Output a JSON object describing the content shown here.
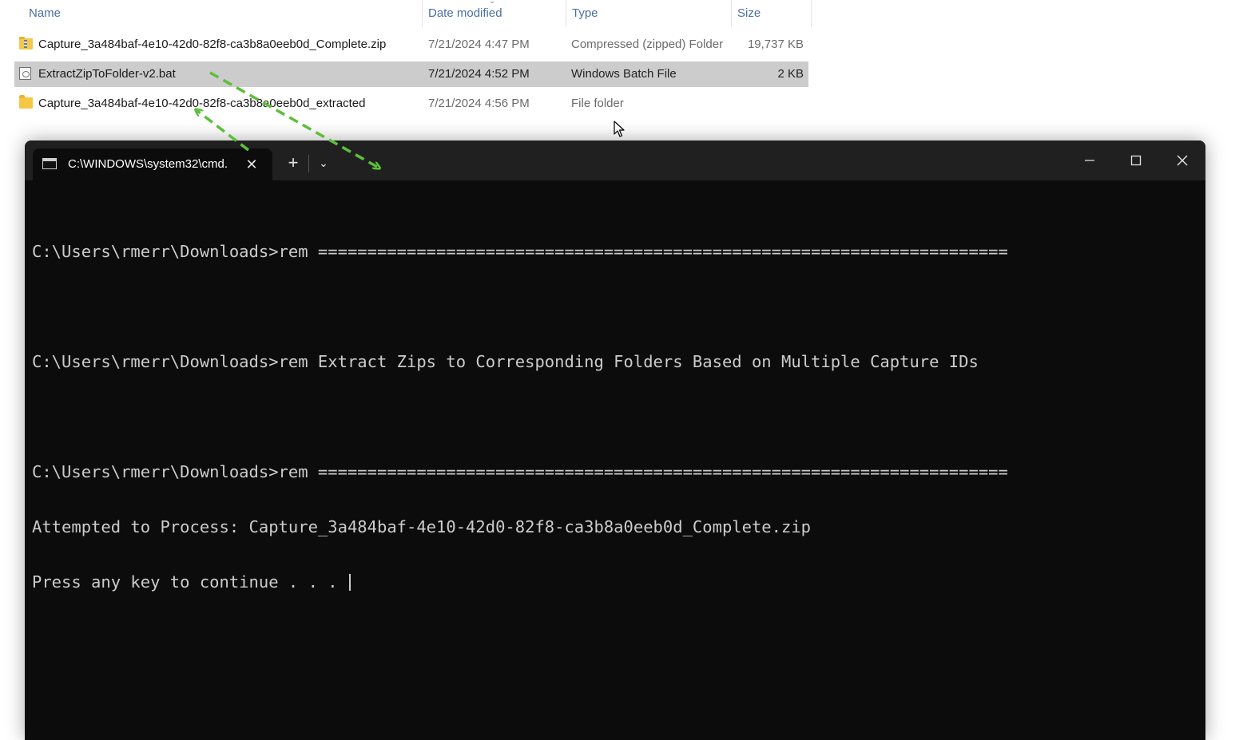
{
  "explorer": {
    "columns": {
      "name": "Name",
      "date_modified": "Date modified",
      "type": "Type",
      "size": "Size"
    },
    "files": [
      {
        "name": "Capture_3a484baf-4e10-42d0-82f8-ca3b8a0eeb0d_Complete.zip",
        "date": "7/21/2024 4:47 PM",
        "type": "Compressed (zipped) Folder",
        "size": "19,737 KB",
        "icon": "zip-folder-icon",
        "selected": false
      },
      {
        "name": "ExtractZipToFolder-v2.bat",
        "date": "7/21/2024 4:52 PM",
        "type": "Windows Batch File",
        "size": "2 KB",
        "icon": "batch-file-icon",
        "selected": true
      },
      {
        "name": "Capture_3a484baf-4e10-42d0-82f8-ca3b8a0eeb0d_extracted",
        "date": "7/21/2024 4:56 PM",
        "type": "File folder",
        "size": "",
        "icon": "folder-icon",
        "selected": false
      }
    ]
  },
  "terminal": {
    "tab_title": "C:\\WINDOWS\\system32\\cmd.",
    "console_lines": [
      "",
      "C:\\Users\\rmerr\\Downloads>rem ======================================================================",
      "",
      "C:\\Users\\rmerr\\Downloads>rem Extract Zips to Corresponding Folders Based on Multiple Capture IDs",
      "",
      "C:\\Users\\rmerr\\Downloads>rem ======================================================================",
      "Attempted to Process: Capture_3a484baf-4e10-42d0-82f8-ca3b8a0eeb0d_Complete.zip",
      "Press any key to continue . . . "
    ]
  },
  "colors": {
    "selected_row": "#cccccc",
    "header_text": "#4a6fa5",
    "terminal_bg": "#0c0c0c",
    "titlebar_bg": "#202020",
    "console_text": "#cccccc",
    "annotation_arrow": "#5cbf3a"
  }
}
